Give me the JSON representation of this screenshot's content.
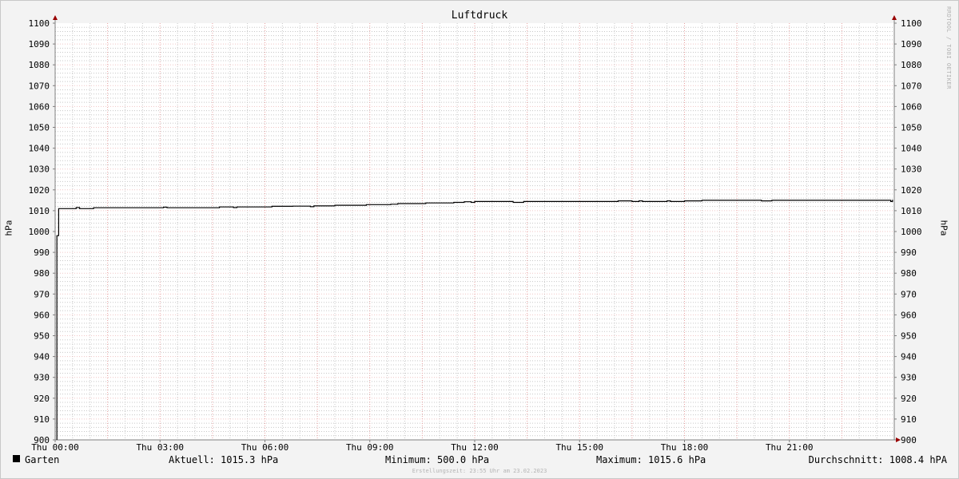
{
  "chart_data": {
    "type": "line",
    "title": "Luftdruck",
    "ylabel": "hPa",
    "ylim": [
      900,
      1100
    ],
    "y_ticks": [
      "900",
      "910",
      "920",
      "930",
      "940",
      "950",
      "960",
      "970",
      "980",
      "990",
      "1000",
      "1010",
      "1020",
      "1030",
      "1040",
      "1050",
      "1060",
      "1070",
      "1080",
      "1090",
      "1100"
    ],
    "x_ticks": [
      "Thu 00:00",
      "Thu 03:00",
      "Thu 06:00",
      "Thu 09:00",
      "Thu 12:00",
      "Thu 15:00",
      "Thu 18:00",
      "Thu 21:00"
    ],
    "x_unit": "hours",
    "xlim": [
      0,
      24
    ],
    "grid": true,
    "series": [
      {
        "name": "Garten",
        "color": "#000000",
        "points": [
          [
            0.05,
            900
          ],
          [
            0.05,
            998
          ],
          [
            0.1,
            998
          ],
          [
            0.1,
            1011
          ],
          [
            0.3,
            1011
          ],
          [
            0.6,
            1011.5
          ],
          [
            0.7,
            1011
          ],
          [
            1.0,
            1011
          ],
          [
            1.1,
            1011.4
          ],
          [
            2.0,
            1011.4
          ],
          [
            3.0,
            1011.4
          ],
          [
            3.1,
            1011.7
          ],
          [
            3.2,
            1011.4
          ],
          [
            4.0,
            1011.4
          ],
          [
            4.6,
            1011.4
          ],
          [
            4.7,
            1011.8
          ],
          [
            5.0,
            1011.8
          ],
          [
            5.1,
            1011.5
          ],
          [
            5.2,
            1011.8
          ],
          [
            6.0,
            1011.8
          ],
          [
            6.2,
            1012.1
          ],
          [
            6.8,
            1012.2
          ],
          [
            7.2,
            1012.2
          ],
          [
            7.3,
            1011.9
          ],
          [
            7.4,
            1012.3
          ],
          [
            7.8,
            1012.3
          ],
          [
            8.0,
            1012.6
          ],
          [
            8.8,
            1012.6
          ],
          [
            8.9,
            1012.9
          ],
          [
            9.6,
            1013.1
          ],
          [
            9.8,
            1013.4
          ],
          [
            10.5,
            1013.4
          ],
          [
            10.6,
            1013.7
          ],
          [
            11.0,
            1013.7
          ],
          [
            11.4,
            1014.0
          ],
          [
            11.7,
            1014.3
          ],
          [
            11.9,
            1014.0
          ],
          [
            12.0,
            1014.4
          ],
          [
            13.0,
            1014.4
          ],
          [
            13.1,
            1014.0
          ],
          [
            13.3,
            1014.0
          ],
          [
            13.4,
            1014.4
          ],
          [
            14.0,
            1014.4
          ],
          [
            16.0,
            1014.4
          ],
          [
            16.1,
            1014.7
          ],
          [
            16.5,
            1014.4
          ],
          [
            16.7,
            1014.7
          ],
          [
            16.8,
            1014.4
          ],
          [
            17.4,
            1014.4
          ],
          [
            17.5,
            1014.7
          ],
          [
            17.6,
            1014.4
          ],
          [
            17.8,
            1014.4
          ],
          [
            18.0,
            1014.7
          ],
          [
            18.4,
            1014.7
          ],
          [
            18.5,
            1015.0
          ],
          [
            20.0,
            1015.0
          ],
          [
            20.2,
            1014.7
          ],
          [
            20.4,
            1014.7
          ],
          [
            20.5,
            1015.0
          ],
          [
            21.0,
            1015.0
          ],
          [
            23.0,
            1015.0
          ],
          [
            23.8,
            1015.0
          ],
          [
            23.9,
            1014.4
          ],
          [
            23.95,
            1015.3
          ]
        ]
      }
    ]
  },
  "legend": {
    "series_label": "Garten",
    "current": "Aktuell: 1015.3 hPa",
    "minimum": "Minimum: 500.0 hPa",
    "maximum": "Maximum: 1015.6 hPa",
    "average": "Durchschnitt: 1008.4 hPA"
  },
  "watermark": "RRDTOOL / TOBI OETIKER",
  "footer": "Erstellungszeit: 23:55 Uhr am 23.02.2023",
  "colors": {
    "background": "#f3f3f3",
    "plot_background": "#ffffff",
    "major_grid": "#e8a0a0",
    "minor_grid": "#c8c8c8",
    "axis": "#808080",
    "arrow": "#990000",
    "line": "#000000"
  }
}
